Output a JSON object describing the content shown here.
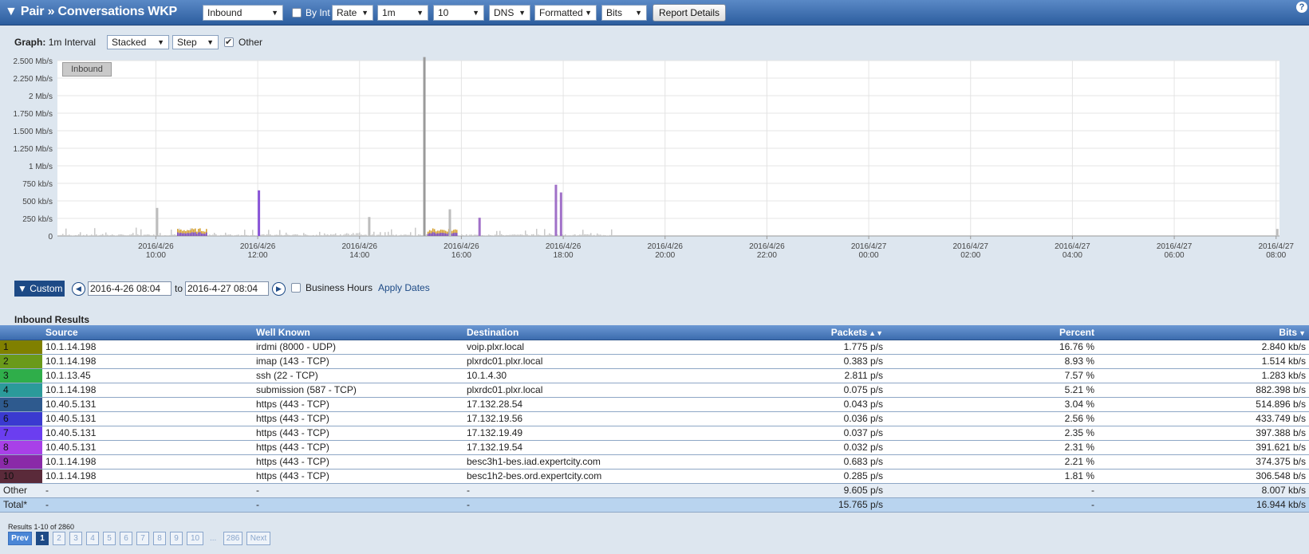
{
  "header": {
    "title": "▼ Pair » Conversations WKP",
    "direction": "Inbound",
    "by_int_label": "By Int",
    "rate": "Rate",
    "interval": "1m",
    "top_n": "10",
    "dns": "DNS",
    "format": "Formatted",
    "units": "Bits",
    "report_button": "Report Details",
    "help": "?"
  },
  "graph_controls": {
    "label": "Graph:",
    "interval_text": "1m Interval",
    "mode": "Stacked",
    "style": "Step",
    "other_label": "Other",
    "other_checked": true
  },
  "chart_data": {
    "type": "bar",
    "legend": "Inbound",
    "y_tick_labels": [
      "0",
      "250 kb/s",
      "500 kb/s",
      "750 kb/s",
      "1 Mb/s",
      "1.250 Mb/s",
      "1.500 Mb/s",
      "1.750 Mb/s",
      "2 Mb/s",
      "2.250 Mb/s",
      "2.500 Mb/s"
    ],
    "ylim": [
      0,
      2500
    ],
    "y_unit": "kb/s",
    "x_tick_labels": [
      [
        "2016/4/26",
        "10:00"
      ],
      [
        "2016/4/26",
        "12:00"
      ],
      [
        "2016/4/26",
        "14:00"
      ],
      [
        "2016/4/26",
        "16:00"
      ],
      [
        "2016/4/26",
        "18:00"
      ],
      [
        "2016/4/26",
        "20:00"
      ],
      [
        "2016/4/26",
        "22:00"
      ],
      [
        "2016/4/27",
        "00:00"
      ],
      [
        "2016/4/27",
        "02:00"
      ],
      [
        "2016/4/27",
        "04:00"
      ],
      [
        "2016/4/27",
        "06:00"
      ],
      [
        "2016/4/27",
        "08:00"
      ]
    ],
    "x_range": [
      "2016-04-26 08:04",
      "2016-04-27 08:04"
    ],
    "grid": true,
    "spikes": [
      {
        "time": "2016-04-26 10:00",
        "value": 400,
        "color": "#bdbdbd"
      },
      {
        "time": "2016-04-26 12:00",
        "value": 650,
        "color": "#8a55d8"
      },
      {
        "time": "2016-04-26 14:10",
        "value": 270,
        "color": "#bdbdbd"
      },
      {
        "time": "2016-04-26 15:15",
        "value": 2550,
        "color": "#9a9a9a"
      },
      {
        "time": "2016-04-26 15:45",
        "value": 380,
        "color": "#bdbdbd"
      },
      {
        "time": "2016-04-26 16:20",
        "value": 260,
        "color": "#a070c8"
      },
      {
        "time": "2016-04-26 17:50",
        "value": 730,
        "color": "#a070c8"
      },
      {
        "time": "2016-04-26 17:56",
        "value": 620,
        "color": "#a070c8"
      },
      {
        "time": "2016-04-27 08:00",
        "value": 100,
        "color": "#bdbdbd"
      }
    ],
    "activity_windows": [
      {
        "start": "2016-04-26 10:25",
        "end": "2016-04-26 11:00",
        "value": 100,
        "color": "#d4a030"
      },
      {
        "start": "2016-04-26 15:20",
        "end": "2016-04-26 15:55",
        "value": 100,
        "color": "#d4a030"
      }
    ]
  },
  "date_range": {
    "mode": "▼ Custom",
    "start": "2016-4-26 08:04",
    "to": "to",
    "end": "2016-4-27 08:04",
    "business_hours": "Business Hours",
    "apply": "Apply Dates"
  },
  "results": {
    "title": "Inbound Results",
    "columns": {
      "source": "Source",
      "well_known": "Well Known",
      "destination": "Destination",
      "packets": "Packets",
      "percent": "Percent",
      "bits": "Bits"
    },
    "rows": [
      {
        "idx": "1",
        "color": "#808000",
        "source": "10.1.14.198",
        "well_known": "irdmi (8000 - UDP)",
        "destination": "voip.plxr.local",
        "packets": "1.775 p/s",
        "percent": "16.76 %",
        "bits": "2.840 kb/s"
      },
      {
        "idx": "2",
        "color": "#6a9a1a",
        "source": "10.1.14.198",
        "well_known": "imap (143 - TCP)",
        "destination": "plxrdc01.plxr.local",
        "packets": "0.383 p/s",
        "percent": "8.93 %",
        "bits": "1.514 kb/s"
      },
      {
        "idx": "3",
        "color": "#2fae4a",
        "source": "10.1.13.45",
        "well_known": "ssh (22 - TCP)",
        "destination": "10.1.4.30",
        "packets": "2.811 p/s",
        "percent": "7.57 %",
        "bits": "1.283 kb/s"
      },
      {
        "idx": "4",
        "color": "#2b9a9a",
        "source": "10.1.14.198",
        "well_known": "submission (587 - TCP)",
        "destination": "plxrdc01.plxr.local",
        "packets": "0.075 p/s",
        "percent": "5.21 %",
        "bits": "882.398 b/s"
      },
      {
        "idx": "5",
        "color": "#2e5a8e",
        "source": "10.40.5.131",
        "well_known": "https (443 - TCP)",
        "destination": "17.132.28.54",
        "packets": "0.043 p/s",
        "percent": "3.04 %",
        "bits": "514.896 b/s"
      },
      {
        "idx": "6",
        "color": "#3a3ad0",
        "source": "10.40.5.131",
        "well_known": "https (443 - TCP)",
        "destination": "17.132.19.56",
        "packets": "0.036 p/s",
        "percent": "2.56 %",
        "bits": "433.749 b/s"
      },
      {
        "idx": "7",
        "color": "#6b3ef0",
        "source": "10.40.5.131",
        "well_known": "https (443 - TCP)",
        "destination": "17.132.19.49",
        "packets": "0.037 p/s",
        "percent": "2.35 %",
        "bits": "397.388 b/s"
      },
      {
        "idx": "8",
        "color": "#a840e8",
        "source": "10.40.5.131",
        "well_known": "https (443 - TCP)",
        "destination": "17.132.19.54",
        "packets": "0.032 p/s",
        "percent": "2.31 %",
        "bits": "391.621 b/s"
      },
      {
        "idx": "9",
        "color": "#8a2aa8",
        "source": "10.1.14.198",
        "well_known": "https (443 - TCP)",
        "destination": "besc3h1-bes.iad.expertcity.com",
        "packets": "0.683 p/s",
        "percent": "2.21 %",
        "bits": "374.375 b/s"
      },
      {
        "idx": "10",
        "color": "#5a2a3a",
        "source": "10.1.14.198",
        "well_known": "https (443 - TCP)",
        "destination": "besc1h2-bes.ord.expertcity.com",
        "packets": "0.285 p/s",
        "percent": "1.81 %",
        "bits": "306.548 b/s"
      }
    ],
    "other": {
      "label": "Other",
      "source": "-",
      "well_known": "-",
      "destination": "-",
      "packets": "9.605 p/s",
      "percent": "-",
      "bits": "8.007 kb/s"
    },
    "total": {
      "label": "Total*",
      "source": "-",
      "well_known": "-",
      "destination": "-",
      "packets": "15.765 p/s",
      "percent": "-",
      "bits": "16.944 kb/s"
    }
  },
  "pagination": {
    "count": "Results 1-10 of 2860",
    "prev": "Prev",
    "pages": [
      "1",
      "2",
      "3",
      "4",
      "5",
      "6",
      "7",
      "8",
      "9",
      "10"
    ],
    "ellipsis": "...",
    "last": "286",
    "next": "Next"
  }
}
